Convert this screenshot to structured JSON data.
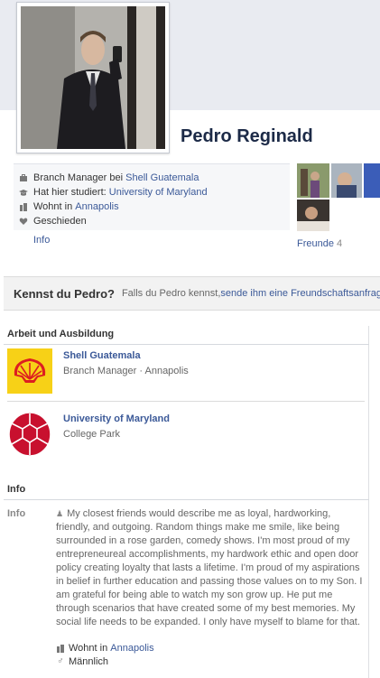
{
  "profile": {
    "name": "Pedro Reginald"
  },
  "about": {
    "work_prefix": "Branch Manager bei ",
    "work_link": "Shell Guatemala",
    "study_prefix": "Hat hier studiert: ",
    "study_link": "University of Maryland",
    "live_prefix": "Wohnt in ",
    "live_link": "Annapolis",
    "relationship": "Geschieden",
    "info_link": "Info"
  },
  "friends": {
    "label": "Freunde",
    "count": "4"
  },
  "kennst": {
    "title": "Kennst du Pedro?",
    "text": "Falls du Pedro kennst, ",
    "link": "sende ihm eine Freundschaftsanfrage"
  },
  "work_section": {
    "title": "Arbeit und Ausbildung",
    "items": [
      {
        "title": "Shell Guatemala",
        "subtitle": "Branch Manager · Annapolis"
      },
      {
        "title": "University of Maryland",
        "subtitle": "College Park"
      }
    ]
  },
  "info_section": {
    "title": "Info",
    "label": "Info",
    "bio": "My closest friends would describe me as loyal, hardworking, friendly, and outgoing. Random things make me smile, like being surrounded in a rose garden, comedy shows. I'm most proud of my entrepreneureal accomplishments, my hardwork ethic and open door policy creating loyalty that lasts a lifetime. I'm proud of my aspirations in belief in further education and passing those values on to my Son. I am grateful for being able to watch my son grow up. He put me through scenarios that have created some of my best memories. My social life needs to be expanded. I only have myself to blame for that.",
    "live_prefix": "Wohnt in ",
    "live_link": "Annapolis",
    "gender": "Männlich"
  },
  "icons": {
    "work": "briefcase-icon",
    "study": "graduation-cap-icon",
    "live": "home-icon",
    "relationship": "heart-icon",
    "bio": "person-icon",
    "gender": "male-icon"
  },
  "colors": {
    "link": "#3b5998",
    "name": "#1c2a47",
    "shell_yellow": "#f7d117",
    "shell_red": "#dd1d21",
    "maryland_red": "#c8102e"
  }
}
